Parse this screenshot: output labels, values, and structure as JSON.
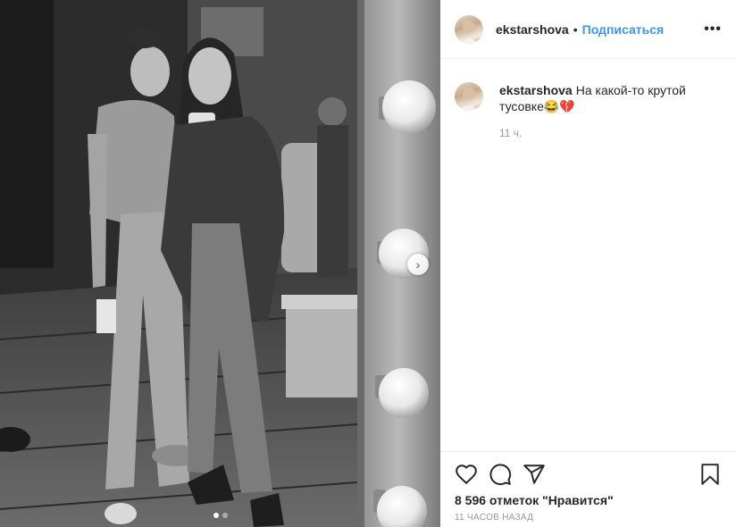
{
  "post": {
    "username": "ekstarshova",
    "separator": "•",
    "follow_label": "Подписаться",
    "more_label": "•••",
    "caption_text": "На какой-то крутой тусовке😂💔",
    "caption_time": "11 ч.",
    "likes_text": "8 596 отметок \"Нравится\"",
    "posted_ago": "11 ЧАСОВ НАЗАД"
  },
  "carousel": {
    "total_slides": 2,
    "active_slide": 1,
    "next_label": "›"
  },
  "icons": {
    "like": "heart-icon",
    "comment": "comment-icon",
    "share": "share-icon",
    "save": "bookmark-icon",
    "next": "chevron-right-icon"
  },
  "colors": {
    "accent": "#3897f0",
    "text": "#262626",
    "muted": "#999999"
  }
}
